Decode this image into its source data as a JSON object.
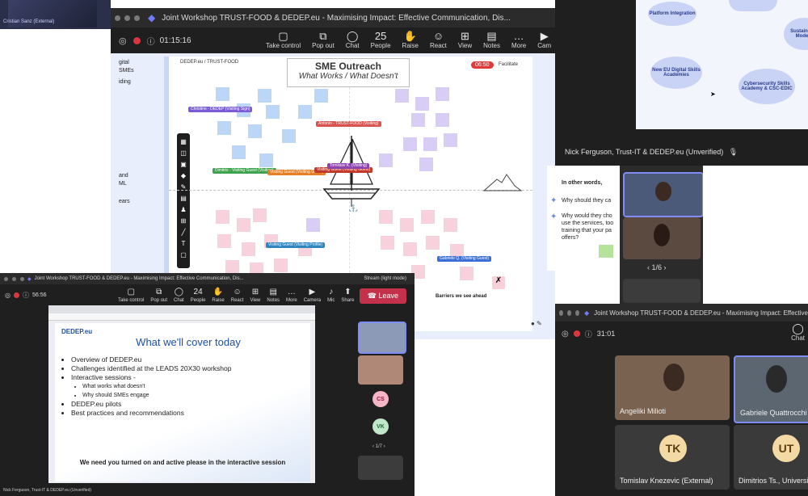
{
  "top_strip": {
    "name": "Cristian Sanz (External)"
  },
  "main_window": {
    "title": "Joint Workshop TRUST-FOOD & DEDEP.eu - Maximising Impact: Effective Communication, Dis...",
    "timer": "01:15:16",
    "toolbar": [
      {
        "label": "Take control",
        "icon": "▢"
      },
      {
        "label": "Pop out",
        "icon": "⧉"
      },
      {
        "label": "Chat",
        "icon": "◯"
      },
      {
        "label": "People",
        "icon": "25"
      },
      {
        "label": "Raise",
        "icon": "✋"
      },
      {
        "label": "React",
        "icon": "☺"
      },
      {
        "label": "View",
        "icon": "⊞"
      },
      {
        "label": "Notes",
        "icon": "▤"
      },
      {
        "label": "More",
        "icon": "…"
      },
      {
        "label": "Cam",
        "icon": "▶"
      }
    ],
    "whiteboard": {
      "tab": "DEDEP.eu / TRUST-FOOD",
      "timer": "06:50",
      "facilitate": "Facilitate",
      "title": "SME Outreach",
      "subtitle": "What Works / What Doesn't",
      "left_fragments": [
        "gital",
        "SMEs",
        "iding",
        "and",
        "ML",
        "ears"
      ],
      "bottom_box_title": "Barriers we see ahead",
      "tags": [
        {
          "text": "Christine - DEDEP (Visiting Sign)",
          "color": "#7b5cd6"
        },
        {
          "text": "Antonio - TRUST-FOOD (Visiting)",
          "color": "#d9534f"
        },
        {
          "text": "Dimitris - Visiting Guest (Visiting)",
          "color": "#3fa34d"
        },
        {
          "text": "Visiting Guest (Visiting Guest)",
          "color": "#e67e22"
        },
        {
          "text": "Visiting Guest (Visiting Guest)",
          "color": "#c0392b"
        },
        {
          "text": "Tomislav K. (Visiting)",
          "color": "#8e44ad"
        },
        {
          "text": "Visiting Guest (Visiting Profile)",
          "color": "#2e86c1"
        },
        {
          "text": "Gabriele Q. (Visiting Guest)",
          "color": "#3b6fd6"
        }
      ]
    }
  },
  "top_right": {
    "clouds": [
      "Platform Integration",
      "New EU Digital Skills Academies",
      "Cybersecurity Skills Academy & CSC-EDIC",
      "Sustainable Models"
    ],
    "presenter": "Nick Ferguson, Trust-IT & DEDEP.eu (Unverified)"
  },
  "mid_right_text": {
    "heading": "In other words,",
    "q1": "Why should they ca",
    "q2": "Why would they cho use the services, too training that your pa offers?"
  },
  "strip_pager": "1/6",
  "bottom_left": {
    "title": "Joint Workshop TRUST-FOOD & DEDEP.eu - Maximising Impact: Effective Communication, Dis...",
    "timer": "56:56",
    "presenter_badge": "Stream (light mode)",
    "leave_label": "Leave",
    "toolbar": [
      {
        "label": "Take control",
        "icon": "▢"
      },
      {
        "label": "Pop out",
        "icon": "⧉"
      },
      {
        "label": "Chat",
        "icon": "◯"
      },
      {
        "label": "People",
        "icon": "24"
      },
      {
        "label": "Raise",
        "icon": "✋"
      },
      {
        "label": "React",
        "icon": "☺"
      },
      {
        "label": "View",
        "icon": "⊞"
      },
      {
        "label": "Notes",
        "icon": "▤"
      },
      {
        "label": "More",
        "icon": "…"
      },
      {
        "label": "Camera",
        "icon": "▶"
      },
      {
        "label": "Mic",
        "icon": "♪"
      },
      {
        "label": "Share",
        "icon": "⬆"
      }
    ],
    "slide": {
      "logo": "DEDEP.eu",
      "heading": "What we'll cover today",
      "bullets": [
        "Overview of DEDEP.eu",
        "Challenges identified at the LEADS 20X30 workshop",
        "Interactive sessions -"
      ],
      "sub_bullets": [
        "What works what doesn't",
        "Why should SMEs engage"
      ],
      "bullets2": [
        "DEDEP.eu pilots",
        "Best practices and recommendations"
      ],
      "cta": "We need you turned on and active please in the interactive session"
    },
    "participants": [
      "CS",
      "VK"
    ],
    "pager": "1/7",
    "footer_name": "Nick Ferguson, Trust-IT & DEDEP.eu (Unverified)"
  },
  "bottom_right": {
    "title": "Joint Workshop TRUST-FOOD & DEDEP.eu - Maximising Impact: Effective",
    "timer": "31:01",
    "chat_label": "Chat",
    "tiles": [
      {
        "name": "Angeliki Milioti",
        "initials": ""
      },
      {
        "name": "Gabriele Quattrocchi (",
        "initials": ""
      },
      {
        "name": "Tomislav Knezevic (External)",
        "initials": "TK",
        "color": "#f3d9a4",
        "text_color": "#5a3d10"
      },
      {
        "name": "Dimitrios Ts., Universi",
        "initials": "UT",
        "color": "#f3d9a4",
        "text_color": "#5a3d10"
      }
    ]
  }
}
